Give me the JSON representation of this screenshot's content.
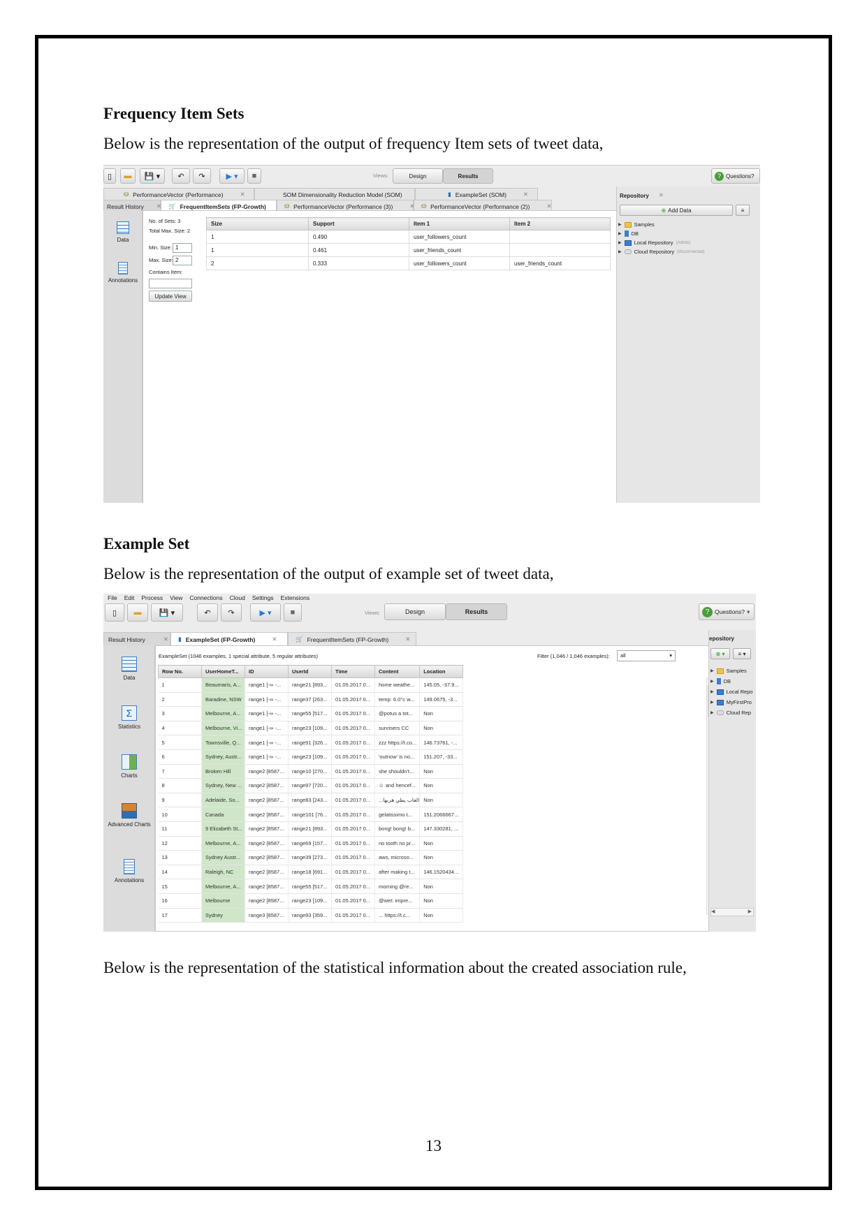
{
  "section1": {
    "heading": "Frequency Item Sets",
    "text": "Below is the representation of the output of frequency Item sets of tweet data,"
  },
  "section2": {
    "heading": "Example Set",
    "text": "Below is the representation of the output of example set of tweet data,"
  },
  "section3": {
    "text": "Below is the representation of the statistical information about the created association rule,"
  },
  "page_number": "13",
  "screenshot1": {
    "views_label": "Views:",
    "view_design": "Design",
    "view_results": "Results",
    "questions": "Questions?",
    "top_tabs": [
      "PerformanceVector (Performance)",
      "SOM Dimensionality Reduction Model (SOM)",
      "ExampleSet (SOM)"
    ],
    "tabs": [
      "Result History",
      "FrequentItemSets (FP-Growth)",
      "PerformanceVector (Performance (3))",
      "PerformanceVector (Performance (2))"
    ],
    "sidebar": [
      "Data",
      "Annotations"
    ],
    "no_of_sets": "No. of Sets: 3",
    "total_max_size": "Total Max. Size: 2",
    "min_size_label": "Min. Size:",
    "min_size_value": "1",
    "max_size_label": "Max. Size:",
    "max_size_value": "2",
    "contains_item_label": "Contains Item:",
    "update_view": "Update View",
    "table": {
      "columns": [
        "Size",
        "Support",
        "Item 1",
        "Item 2"
      ],
      "rows": [
        [
          "1",
          "0.490",
          "user_followers_count",
          ""
        ],
        [
          "1",
          "0.461",
          "user_friends_count",
          ""
        ],
        [
          "2",
          "0.333",
          "user_followers_count",
          "user_friends_count"
        ]
      ]
    },
    "repository": {
      "title": "Repository",
      "add_data": "Add Data",
      "items": [
        "Samples",
        "DB",
        "Local Repository",
        "Cloud Repository"
      ],
      "local_note": "(Admin)",
      "cloud_note": "(disconnected)"
    }
  },
  "screenshot2": {
    "menu": [
      "File",
      "Edit",
      "Process",
      "View",
      "Connections",
      "Cloud",
      "Settings",
      "Extensions"
    ],
    "views_label": "Views:",
    "view_design": "Design",
    "view_results": "Results",
    "questions": "Questions?",
    "tabs": [
      "Result History",
      "ExampleSet (FP-Growth)",
      "FrequentItemSets (FP-Growth)"
    ],
    "sidebar": [
      "Data",
      "Statistics",
      "Charts",
      "Advanced Charts",
      "Annotations"
    ],
    "summary": "ExampleSet (1046 examples, 1 special attribute, 5 regular attributes)",
    "filter_label": "Filter (1,046 / 1,046 examples):",
    "filter_value": "all",
    "repository": {
      "title": "epository",
      "items": [
        "Samples",
        "DB",
        "Local Repo",
        "MyFirstPro",
        "Cloud Rep"
      ]
    },
    "table": {
      "columns": [
        "Row No.",
        "UserHomeT...",
        "ID",
        "UserId",
        "Time",
        "Content",
        "Location"
      ],
      "rows": [
        [
          "1",
          "Beaumaris, A...",
          "range1 [-∞ -...",
          "range21 [893...",
          "01.05.2017 0...",
          "home weathe...",
          "145.05, -37.9..."
        ],
        [
          "2",
          "Baradine, NSW",
          "range1 [-∞ -...",
          "range37 [263...",
          "01.05.2017 0...",
          "temp: 6.0°c w...",
          "149.0675, -3..."
        ],
        [
          "3",
          "Melbourne, A...",
          "range1 [-∞ -...",
          "range55 [517...",
          "01.05.2017 0...",
          "@potus a tot...",
          "Non"
        ],
        [
          "4",
          "Melbourne, Vi...",
          "range1 [-∞ -...",
          "range23 [109...",
          "01.05.2017 0...",
          "sunrisers CC",
          "Non"
        ],
        [
          "5",
          "Townsville, Q...",
          "range1 [-∞ -...",
          "range91 [326...",
          "01.05.2017 0...",
          "zzz https://t.co...",
          "146.73761, -..."
        ],
        [
          "6",
          "Sydney, Austr...",
          "range1 [-∞ -...",
          "range23 [109...",
          "01.05.2017 0...",
          "'outnow' is no...",
          "151.207, -33..."
        ],
        [
          "7",
          "Broken Hill",
          "range2 [8587...",
          "range10 [270...",
          "01.05.2017 0...",
          "she shouldn't...",
          "Non"
        ],
        [
          "8",
          "Sydney, New ...",
          "range2 [8587...",
          "range97 [720...",
          "01.05.2017 0...",
          "☺ and hencef...",
          "Non"
        ],
        [
          "9",
          "Adelaide, So...",
          "range2 [8587...",
          "range83 [243...",
          "01.05.2017 0...",
          "...العاب يطي هربها",
          "Non"
        ],
        [
          "10",
          "Canada",
          "range2 [8587...",
          "range101 [76...",
          "01.05.2017 0...",
          "gelatissimo t...",
          "151.2066667..."
        ],
        [
          "11",
          "9 Elizabeth St...",
          "range2 [8587...",
          "range21 [893...",
          "01.05.2017 0...",
          "bong! bong! b...",
          "147.330281, ..."
        ],
        [
          "12",
          "Melbourne, A...",
          "range2 [8587...",
          "range69 [157...",
          "01.05.2017 0...",
          "no tooth no pr...",
          "Non"
        ],
        [
          "13",
          "Sydney Austr...",
          "range2 [8587...",
          "range39 [273...",
          "01.05.2017 0...",
          "aws, microso...",
          "Non"
        ],
        [
          "14",
          "Raleigh, NC",
          "range2 [8587...",
          "range18 [691...",
          "01.05.2017 0...",
          "after making t...",
          "146.1520434..."
        ],
        [
          "15",
          "Melbourne, A...",
          "range2 [8587...",
          "range55 [517...",
          "01.05.2017 0...",
          "morning @re...",
          "Non"
        ],
        [
          "16",
          "Melbourne",
          "range2 [8587...",
          "range23 [109...",
          "01.05.2017 0...",
          "@wet: impre...",
          "Non"
        ],
        [
          "17",
          "Sydney",
          "range3 [8587...",
          "range93 [359...",
          "01.05.2017 0...",
          "... https://t.c...",
          "Non"
        ]
      ]
    }
  }
}
